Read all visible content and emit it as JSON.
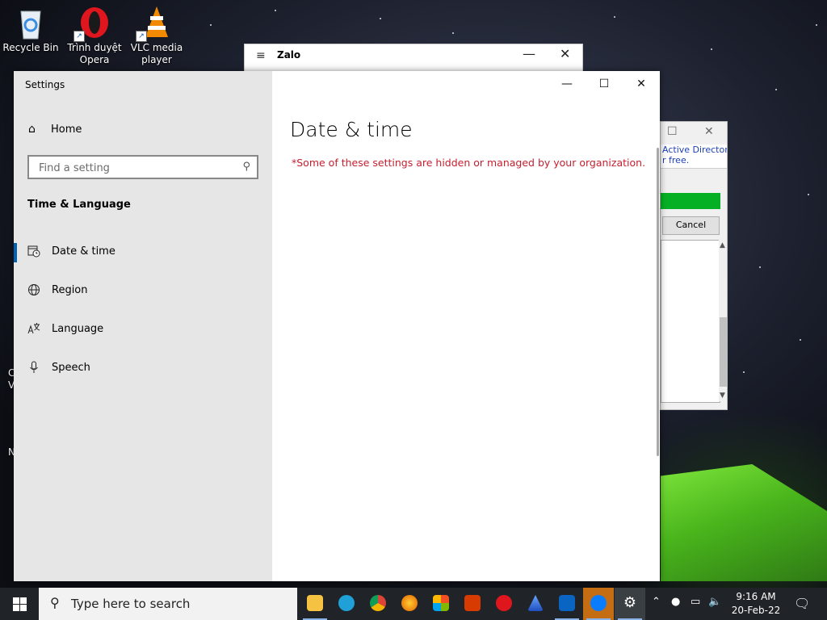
{
  "desktop": {
    "icons": [
      {
        "label_line1": "Recycle Bin",
        "label_line2": ""
      },
      {
        "label_line1": "Trình duyệt",
        "label_line2": "Opera"
      },
      {
        "label_line1": "VLC media",
        "label_line2": "player"
      }
    ],
    "left_fragments": [
      "C",
      "V",
      "N"
    ]
  },
  "zalo": {
    "title": "Zalo",
    "menu_glyph": "≡",
    "min_glyph": "—",
    "close_glyph": "✕"
  },
  "background_dialog": {
    "info_line1": "Active Directory.",
    "info_line2": "r free.",
    "progress": 1.0,
    "cancel_label": "Cancel"
  },
  "settings": {
    "window_title": "Settings",
    "home_label": "Home",
    "search_placeholder": "Find a setting",
    "section_title": "Time & Language",
    "nav": [
      {
        "label": "Date & time",
        "icon": "calendar-clock-icon",
        "selected": true
      },
      {
        "label": "Region",
        "icon": "globe-icon",
        "selected": false
      },
      {
        "label": "Language",
        "icon": "language-icon",
        "selected": false
      },
      {
        "label": "Speech",
        "icon": "microphone-icon",
        "selected": false
      }
    ],
    "page_title": "Date & time",
    "managed_notice": "*Some of these settings are hidden or managed by your organization.",
    "accent_color": "#0063b1",
    "notice_color": "#c4202f"
  },
  "taskbar": {
    "search_text": "Type here to search",
    "apps": [
      "file-explorer-icon",
      "edge-icon",
      "chrome-icon",
      "firefox-icon",
      "store-icon",
      "office-icon",
      "opera-icon",
      "app-icon",
      "mail-icon",
      "zalo-icon",
      "settings-icon"
    ],
    "time": "9:16 AM",
    "date": "20-Feb-22"
  }
}
